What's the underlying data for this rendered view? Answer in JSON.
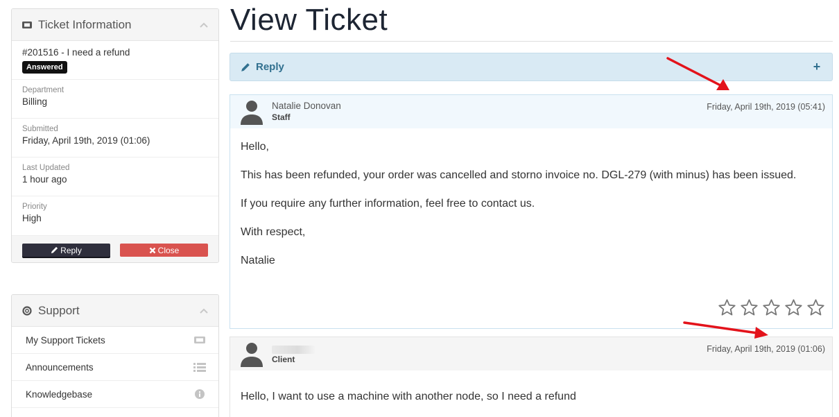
{
  "sidebar": {
    "ticket_panel": {
      "title": "Ticket Information",
      "subject": "#201516 - I need a refund",
      "status_badge": "Answered",
      "fields": {
        "department": {
          "label": "Department",
          "value": "Billing"
        },
        "submitted": {
          "label": "Submitted",
          "value": "Friday, April 19th, 2019 (01:06)"
        },
        "last_updated": {
          "label": "Last Updated",
          "value": "1 hour ago"
        },
        "priority": {
          "label": "Priority",
          "value": "High"
        }
      },
      "buttons": {
        "reply": "Reply",
        "close": "Close"
      }
    },
    "support_panel": {
      "title": "Support",
      "items": [
        {
          "label": "My Support Tickets",
          "icon": "ticket-icon"
        },
        {
          "label": "Announcements",
          "icon": "list-icon"
        },
        {
          "label": "Knowledgebase",
          "icon": "info-icon"
        }
      ]
    }
  },
  "main": {
    "title": "View Ticket",
    "reply_bar": {
      "label": "Reply",
      "expand": "+"
    },
    "messages": [
      {
        "author": "Natalie Donovan",
        "role": "Staff",
        "date": "Friday, April 19th, 2019 (05:41)",
        "paragraphs": [
          "Hello,",
          "This has been refunded, your order was cancelled and storno invoice no. DGL-279 (with minus) has been issued.",
          "If you require any further information, feel free to contact us.",
          "With respect,",
          "Natalie"
        ],
        "rating_stars": 5
      },
      {
        "author": "",
        "role": "Client",
        "date": "Friday, April 19th, 2019 (01:06)",
        "paragraphs": [
          "Hello, I want to use a machine with another node, so I need a refund"
        ]
      }
    ]
  },
  "colors": {
    "reply_bar_bg": "#d9eaf4",
    "reply_bar_text": "#31708f",
    "badge_bg": "#111111",
    "close_button": "#d9534f",
    "reply_button": "#2f2f3d",
    "annotation_arrow": "#e3131b"
  }
}
